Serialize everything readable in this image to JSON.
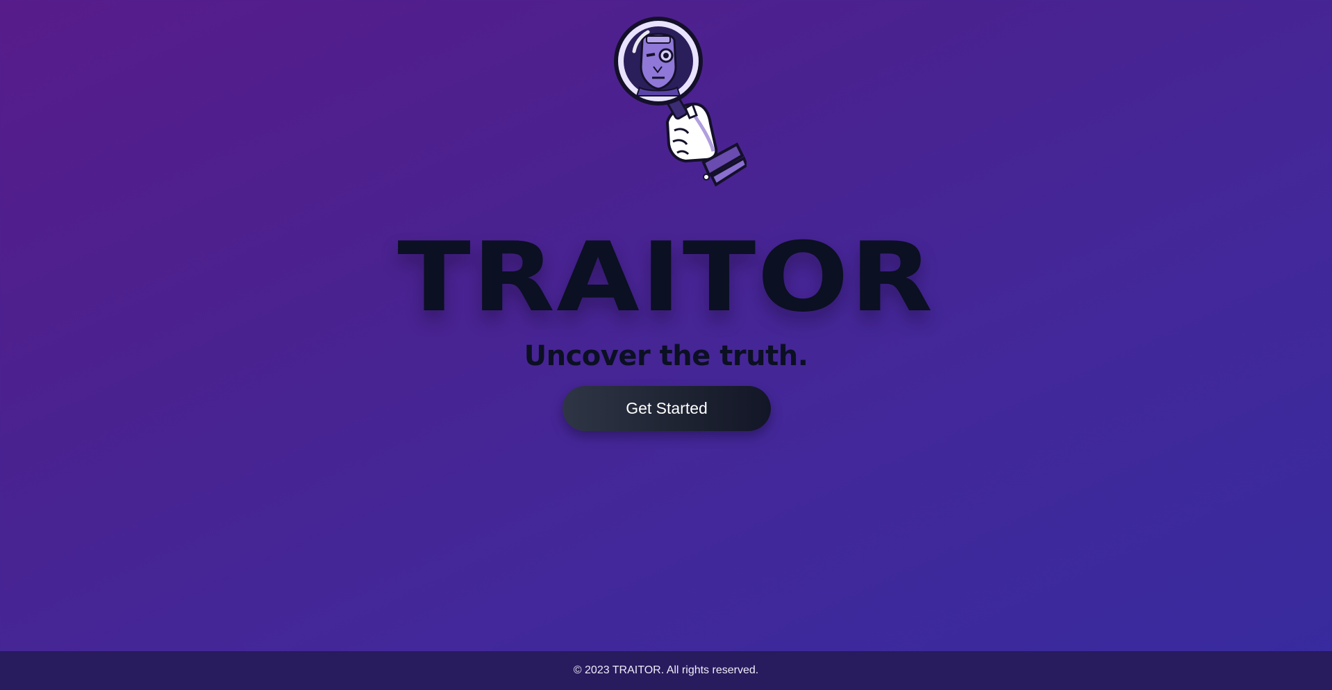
{
  "logo": {
    "icon": "magnifying-glass-hand-robot-face-icon"
  },
  "hero": {
    "title": "TRAITOR",
    "tagline": "Uncover the truth.",
    "cta_label": "Get Started"
  },
  "footer": {
    "copyright": "© 2023 TRAITOR. All rights reserved."
  },
  "colors": {
    "background_start": "#571c8a",
    "background_end": "#372b9e",
    "text_dark": "#0b1022",
    "button": "#1f2433",
    "footer_bg": "#281b5e"
  }
}
